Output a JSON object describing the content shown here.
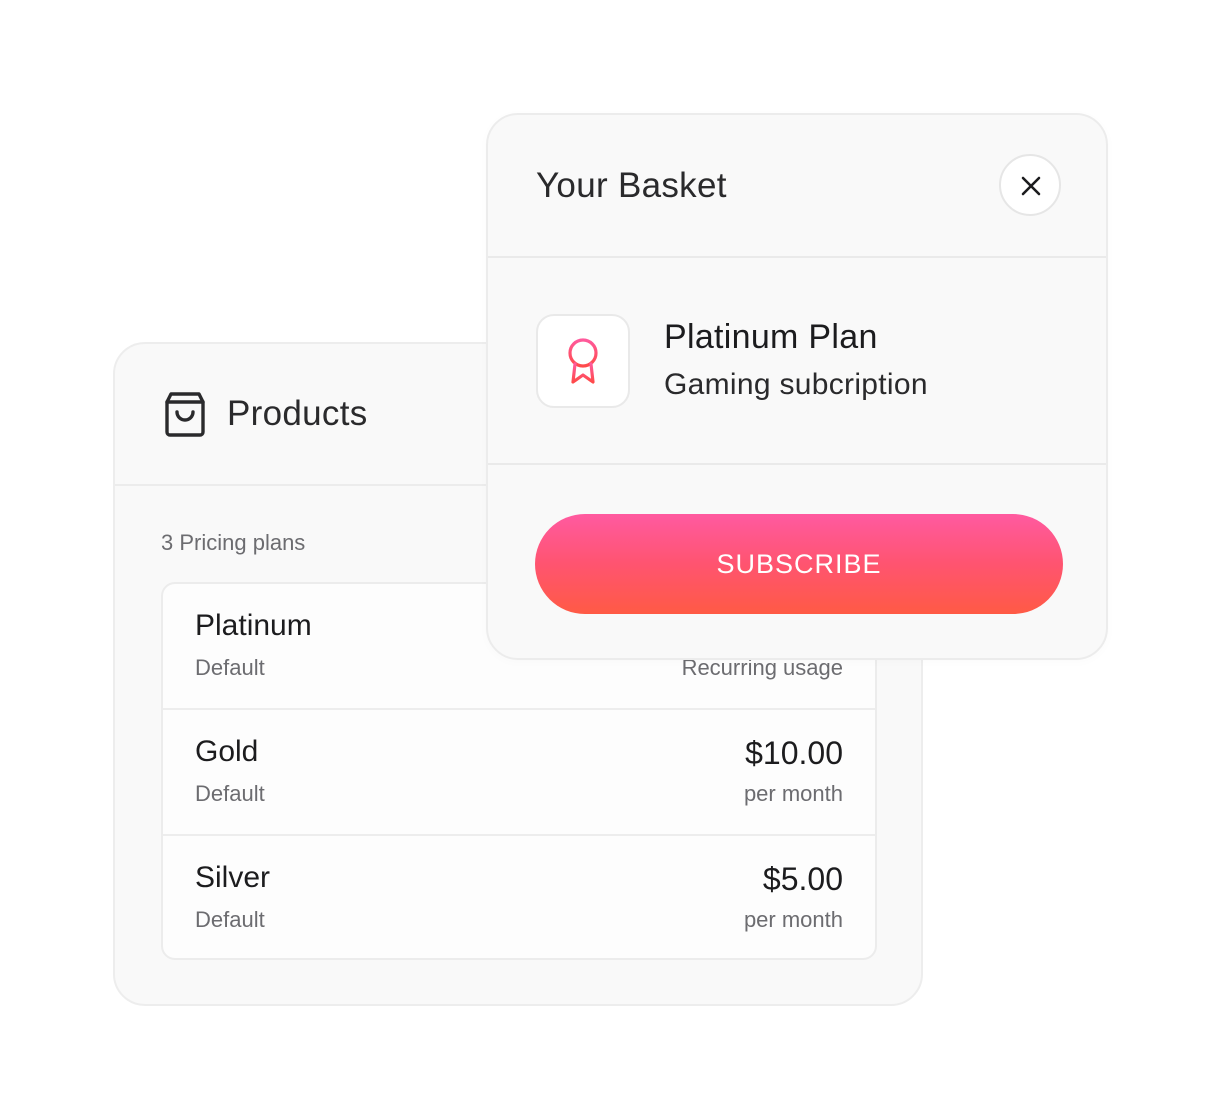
{
  "products": {
    "title": "Products",
    "plans_count_label": "3 Pricing plans",
    "plans": [
      {
        "name": "Platinum",
        "type": "Default",
        "price": "",
        "period": "Recurring usage"
      },
      {
        "name": "Gold",
        "type": "Default",
        "price": "$10.00",
        "period": "per month"
      },
      {
        "name": "Silver",
        "type": "Default",
        "price": "$5.00",
        "period": "per month"
      }
    ]
  },
  "basket": {
    "title": "Your Basket",
    "item": {
      "name": "Platinum Plan",
      "description": "Gaming subcription",
      "icon": "award-ribbon-icon"
    },
    "subscribe_label": "SUBSCRIBE"
  },
  "colors": {
    "accent_gradient_top": "#ff5aa0",
    "accent_gradient_bottom": "#ff5a45",
    "icon_accent": "#ff4d6d"
  }
}
